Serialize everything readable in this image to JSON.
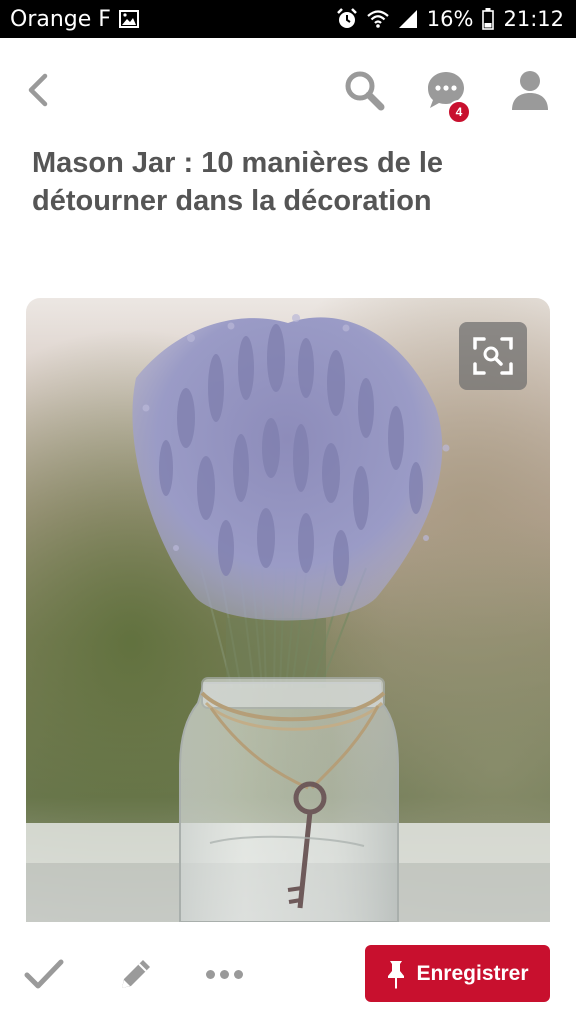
{
  "status_bar": {
    "carrier": "Orange F",
    "battery": "16%",
    "time": "21:12",
    "icons": [
      "image-icon",
      "alarm-icon",
      "wifi-icon",
      "signal-icon",
      "battery-icon"
    ]
  },
  "nav": {
    "icons": [
      "back-icon",
      "search-icon",
      "messages-icon",
      "profile-icon"
    ],
    "messages_badge": "4"
  },
  "pin": {
    "title": "Mason Jar : 10 manières de le détourner dans la décoration",
    "image_icons": [
      "visual-search-icon"
    ]
  },
  "bottom_bar": {
    "icons": [
      "check-icon",
      "pencil-icon",
      "more-icon",
      "pin-icon"
    ],
    "save_label": "Enregistrer"
  },
  "colors": {
    "accent": "#c8102e",
    "icon_gray": "#9a9a9a",
    "title_text": "#555555",
    "status_bar_bg": "#000000"
  }
}
